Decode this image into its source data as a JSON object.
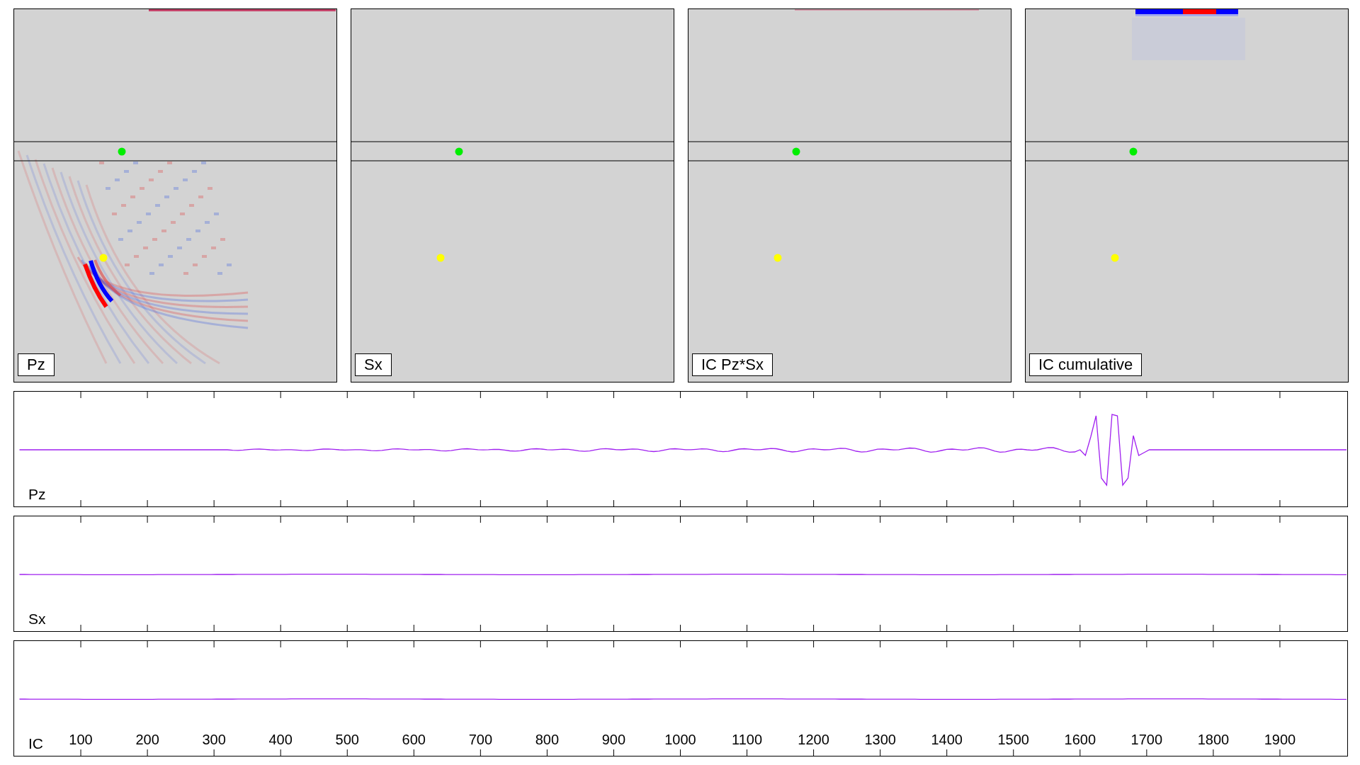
{
  "image_panels": [
    {
      "label": "Pz",
      "kind": "wavefield"
    },
    {
      "label": "Sx",
      "kind": "flat"
    },
    {
      "label": "IC Pz*Sx",
      "kind": "faint-top"
    },
    {
      "label": "IC cumulative",
      "kind": "top-band"
    }
  ],
  "traces": [
    {
      "label": "Pz",
      "kind": "wiggle"
    },
    {
      "label": "Sx",
      "kind": "flat"
    },
    {
      "label": "IC",
      "kind": "flat",
      "tick_labels": [
        "100",
        "200",
        "300",
        "400",
        "500",
        "600",
        "700",
        "800",
        "900",
        "1000",
        "1100",
        "1200",
        "1300",
        "1400",
        "1500",
        "1600",
        "1700",
        "1800",
        "1900"
      ]
    }
  ]
}
